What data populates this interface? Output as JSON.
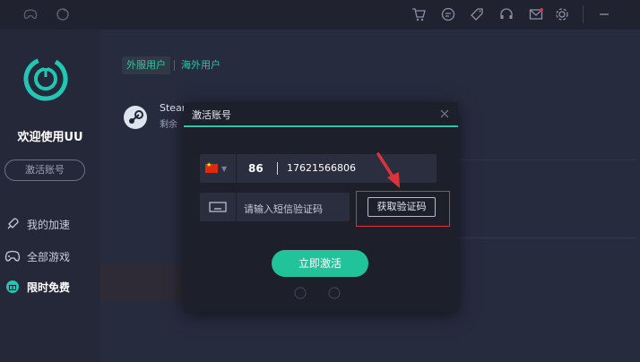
{
  "sidebar": {
    "welcome": "欢迎使用UU",
    "activate_account_label": "激活账号",
    "nav": [
      {
        "label": "我的加速",
        "icon": "rocket-icon"
      },
      {
        "label": "全部游戏",
        "icon": "gamepad-icon"
      },
      {
        "label": "限时免费",
        "icon": "gift-icon"
      }
    ]
  },
  "main": {
    "tabs": [
      {
        "label": "外服用户",
        "active": true
      },
      {
        "label": "海外用户",
        "active": false
      }
    ],
    "steam_item": {
      "title": "Stear",
      "subtitle": "剩余"
    }
  },
  "dialog": {
    "title": "激活账号",
    "country_code": "86",
    "phone_number": "17621566806",
    "code_placeholder": "请输入短信验证码",
    "get_code_label": "获取验证码",
    "submit_label": "立即激活"
  },
  "colors": {
    "accent": "#2ec6a8",
    "button": "#20c39a",
    "highlight": "#d9343c"
  }
}
